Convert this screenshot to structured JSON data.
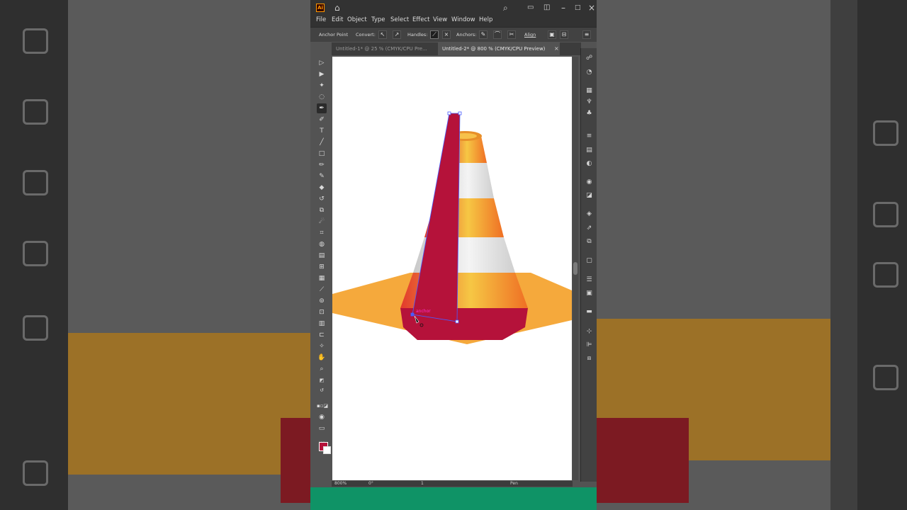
{
  "app": {
    "logo_text": "Ai",
    "menu": [
      "File",
      "Edit",
      "Object",
      "Type",
      "Select",
      "Effect",
      "View",
      "Window",
      "Help"
    ],
    "control_bar": {
      "anchor_point": "Anchor Point",
      "convert": "Convert:",
      "handles": "Handles:",
      "anchors": "Anchors:",
      "align": "Align"
    },
    "tabs": [
      {
        "label": "Untitled-1* @ 25 % (CMYK/CPU Pre...",
        "active": false
      },
      {
        "label": "Untitled-2* @ 800 % (CMYK/CPU Preview)",
        "active": true
      }
    ],
    "tab_close": "×",
    "canvas": {
      "anchor_label": "anchor"
    },
    "status": {
      "zoom": "800%",
      "rotation": "0°",
      "artboard": "1",
      "tool": "Pen"
    },
    "colors": {
      "fill": "#b5123a",
      "stroke": "#ffffff",
      "cone_red": "#b5123a",
      "cone_orange": "#f07a22",
      "cone_white": "#e6e6e6",
      "base_orange": "#f5a93c",
      "bottom_bar": "#0f9366"
    }
  }
}
